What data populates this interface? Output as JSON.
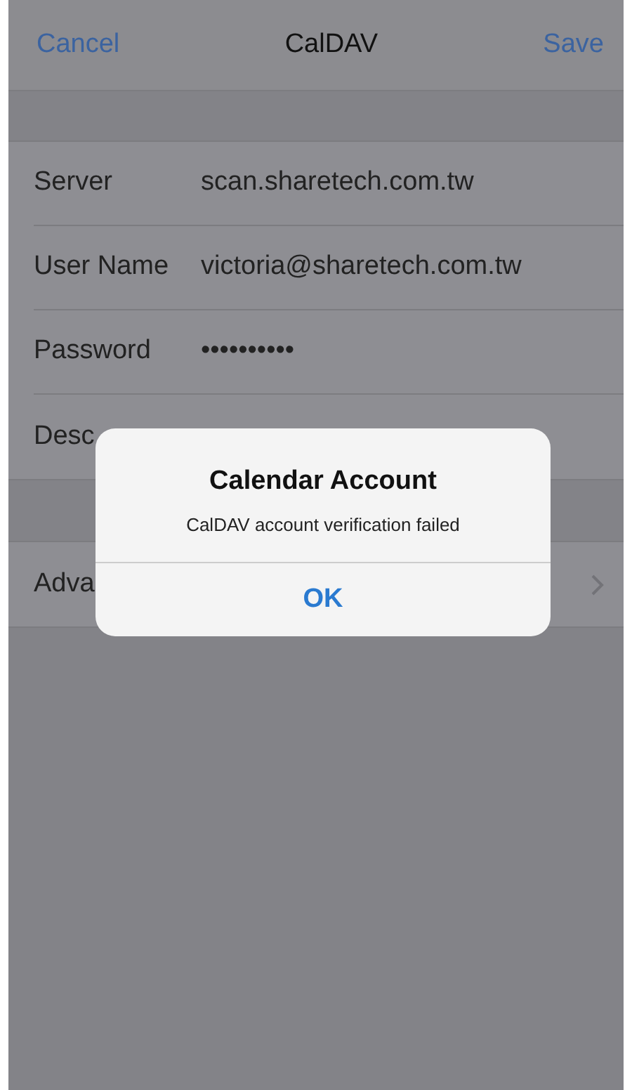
{
  "nav_bar": {
    "cancel": "Cancel",
    "title": "CalDAV",
    "save": "Save"
  },
  "fields": [
    {
      "label": "Server",
      "value": "scan.sharetech.com.tw"
    },
    {
      "label": "User Name",
      "value": "victoria@sharetech.com.tw"
    },
    {
      "label": "Password",
      "value": "••••••••••"
    },
    {
      "label": "Desc"
    }
  ],
  "advanced": {
    "label": "Adva"
  },
  "alert": {
    "title": "Calendar Account",
    "message": "CalDAV account verification failed",
    "button": "OK"
  }
}
